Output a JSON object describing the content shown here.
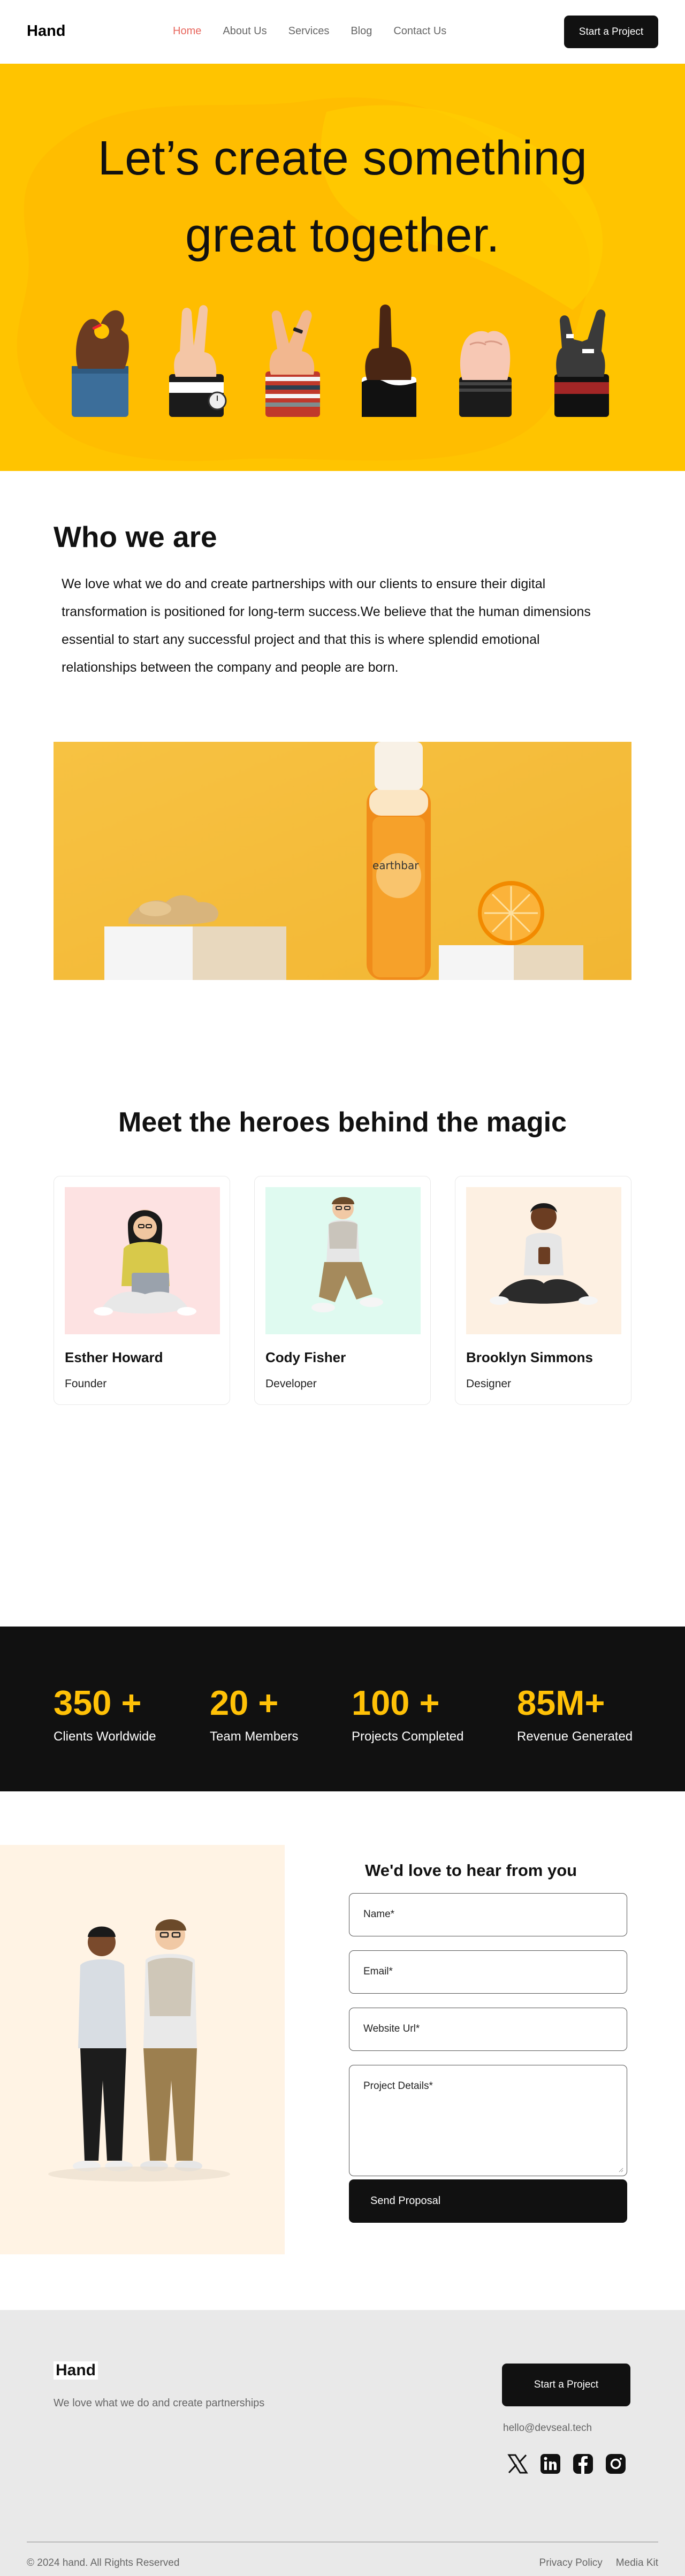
{
  "header": {
    "logo": "Hand",
    "nav": [
      {
        "label": "Home",
        "active": true
      },
      {
        "label": "About Us",
        "active": false
      },
      {
        "label": "Services",
        "active": false
      },
      {
        "label": "Blog",
        "active": false
      },
      {
        "label": "Contact Us",
        "active": false
      }
    ],
    "cta": "Start a Project"
  },
  "hero": {
    "title_line1": "Let’s create something",
    "title_line2": "great together.",
    "background": "#ffc400",
    "hand_icons": [
      "ok-hand-icon",
      "peace-hand-icon",
      "peace-ring-hand-icon",
      "pointing-hand-icon",
      "fist-hand-icon",
      "rock-hand-icon"
    ]
  },
  "who": {
    "heading": "Who we are",
    "body": "We love what we do and create partnerships with our clients to ensure their digital transformation is positioned for long-term success.We believe that the human dimensions essential to start any successful project and that this is where splendid emotional relationships between the company and people are born."
  },
  "banner": {
    "bottle_brand": "earthbar"
  },
  "team": {
    "heading": "Meet the heroes behind the magic",
    "members": [
      {
        "name": "Esther Howard",
        "role": "Founder",
        "bg": "#fde2e2"
      },
      {
        "name": "Cody Fisher",
        "role": "Developer",
        "bg": "#dffaf0"
      },
      {
        "name": "Brooklyn Simmons",
        "role": "Designer",
        "bg": "#fdf0e2"
      }
    ]
  },
  "stats": [
    {
      "value": "350 +",
      "label": "Clients Worldwide"
    },
    {
      "value": "20 +",
      "label": "Team Members"
    },
    {
      "value": "100 +",
      "label": "Projects Completed"
    },
    {
      "value": "85M+",
      "label": "Revenue Generated"
    }
  ],
  "contact": {
    "heading": "We'd love to hear from you",
    "fields": {
      "name": "Name*",
      "email": "Email*",
      "website": "Website Url*",
      "details": "Project Details*"
    },
    "submit": "Send Proposal"
  },
  "footer": {
    "logo": "Hand",
    "tagline": "We love what we do and create partnerships",
    "cta": "Start a Project",
    "email": "hello@devseal.tech",
    "socials": [
      "x-icon",
      "linkedin-icon",
      "facebook-icon",
      "instagram-icon"
    ],
    "copyright": "© 2024 hand. All Rights Reserved",
    "links": [
      "Privacy Policy",
      "Media Kit"
    ]
  },
  "colors": {
    "accent": "#ffc107",
    "nav_active": "#e8675e",
    "dark": "#111111"
  }
}
